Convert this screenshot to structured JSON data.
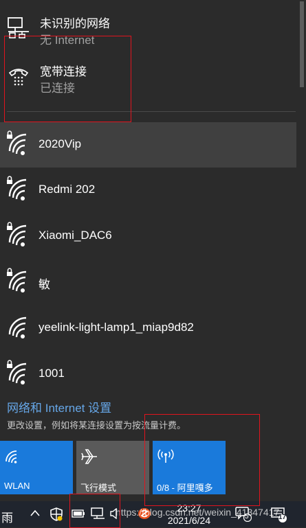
{
  "connections": [
    {
      "name": "未识别的网络",
      "status": "无 Internet",
      "icon": "wired-network-icon"
    },
    {
      "name": "宽带连接",
      "status": "已连接",
      "icon": "dialup-broadband-icon"
    }
  ],
  "networks": [
    {
      "name": "2020Vip",
      "secured": true,
      "selected": true
    },
    {
      "name": "Redmi 202",
      "secured": true
    },
    {
      "name": "Xiaomi_DAC6",
      "secured": true
    },
    {
      "name": "敏",
      "secured": true
    },
    {
      "name": "yeelink-light-lamp1_miap9d82",
      "secured": false
    },
    {
      "name": "1001",
      "secured": true
    }
  ],
  "settings": {
    "link": "网络和 Internet 设置",
    "description": "更改设置，例如将某连接设置为按流量计费。"
  },
  "quick_actions": [
    {
      "label": "WLAN",
      "state": "on",
      "icon": "wifi-icon"
    },
    {
      "label": "飞行模式",
      "state": "off",
      "icon": "airplane-icon"
    },
    {
      "label": "0/8 - 阿里嘎多",
      "state": "on",
      "icon": "mobile-hotspot-icon"
    }
  ],
  "taskbar": {
    "weather": "雨",
    "time": "23:27",
    "date": "2021/6/24",
    "chat_badge": "5",
    "notification_count": "17"
  },
  "watermark": "https://blog.csdn.net/weixin_41347417",
  "colors": {
    "panel_bg": "#2b2b2b",
    "selected_bg": "#404040",
    "accent": "#1a7adb",
    "link": "#66a7e8",
    "annotation": "#e3141e"
  }
}
